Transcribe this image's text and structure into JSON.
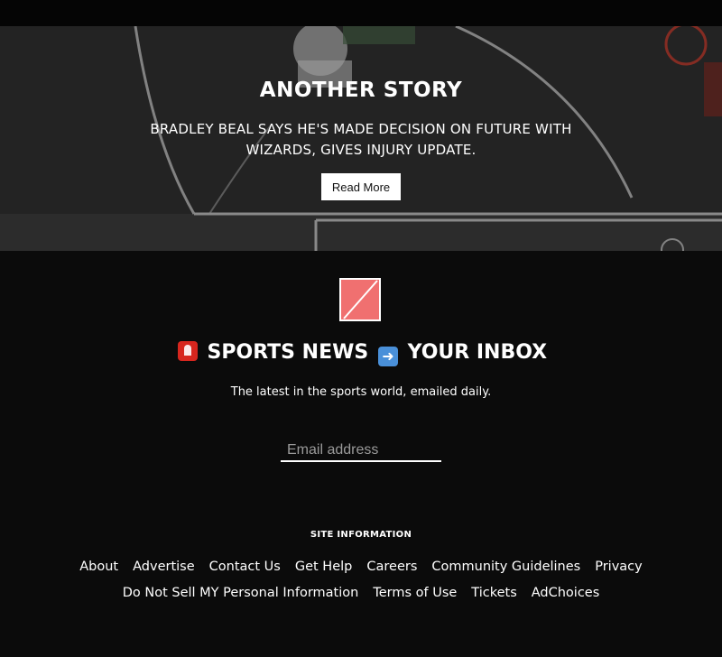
{
  "hero": {
    "title": "ANOTHER STORY",
    "subtitle": "BRADLEY BEAL SAYS HE'S MADE DECISION ON FUTURE WITH WIZARDS, GIVES INJURY UPDATE.",
    "button_label": "Read More"
  },
  "newsletter": {
    "logo_icon": "broken-image-icon",
    "title_siren_icon": "rotating-light-emoji-icon",
    "title_part1": "SPORTS NEWS",
    "title_arrow_icon": "right-arrow-emoji-icon",
    "title_part2": "YOUR INBOX",
    "description": "The latest in the sports world, emailed daily.",
    "email_placeholder": "Email address"
  },
  "footer": {
    "heading": "SITE INFORMATION",
    "links_row1": [
      "About",
      "Advertise",
      "Contact Us",
      "Get Help",
      "Careers",
      "Community Guidelines",
      "Privacy"
    ],
    "links_row2": [
      "Do Not Sell MY Personal Information",
      "Terms of Use",
      "Tickets",
      "AdChoices"
    ]
  },
  "colors": {
    "background": "#0b0b0b",
    "logo_fill": "#f07070",
    "siren": "#d7261e",
    "arrow_box": "#4a90d9"
  }
}
